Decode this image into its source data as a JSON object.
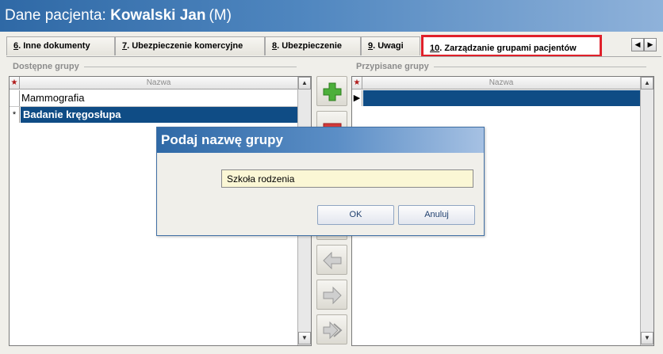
{
  "window": {
    "title_prefix": "Dane pacjenta: ",
    "patient_name": "Kowalski Jan",
    "patient_sex": "(M)"
  },
  "tabs": [
    {
      "num": "6",
      "label": ". Inne dokumenty"
    },
    {
      "num": "7",
      "label": ". Ubezpieczenie komercyjne"
    },
    {
      "num": "8",
      "label": ". Ubezpieczenie"
    },
    {
      "num": "9",
      "label": ". Uwagi"
    },
    {
      "num": "10",
      "label": ". Zarządzanie grupami pacjentów",
      "active": true
    }
  ],
  "tab_nav": {
    "prev": "◀",
    "next": "▶"
  },
  "available_groups": {
    "header": "Dostępne grupy",
    "column": "Nazwa",
    "star": "★",
    "rows": [
      {
        "indicator": "",
        "name": "Mammografia",
        "selected": false
      },
      {
        "indicator": "*",
        "name": "Badanie kręgosłupa",
        "selected": true
      }
    ]
  },
  "assigned_groups": {
    "header": "Przypisane grupy",
    "column": "Nazwa",
    "star": "★",
    "rows": [
      {
        "indicator": "▶",
        "name": "",
        "selected": true
      }
    ]
  },
  "scroll": {
    "up": "▲",
    "down": "▼"
  },
  "dialog": {
    "title": "Podaj nazwę grupy",
    "input_value": "Szkoła rodzenia",
    "ok_label": "OK",
    "cancel_label": "Anuluj"
  }
}
